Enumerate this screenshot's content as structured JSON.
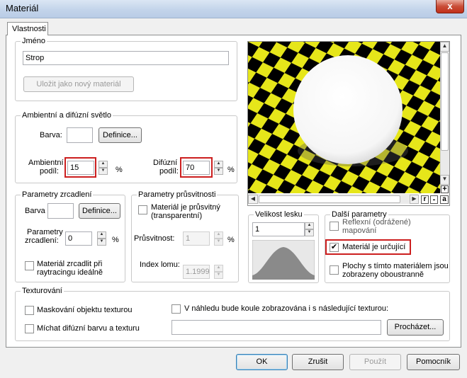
{
  "window": {
    "title": "Materiál",
    "close_glyph": "x"
  },
  "tabs": [
    {
      "label": "Vlastnosti"
    }
  ],
  "name_group": {
    "legend": "Jméno",
    "value": "Strop",
    "save_button": "Uložit jako nový materiál"
  },
  "ambient_group": {
    "legend": "Ambientní a difúzní světlo",
    "color_label": "Barva:",
    "define_button": "Definice...",
    "ambient_label_1": "Ambientní",
    "ambient_label_2": "podíl:",
    "ambient_value": "15",
    "ambient_unit": "%",
    "diffuse_label_1": "Difúzní",
    "diffuse_label_2": "podíl:",
    "diffuse_value": "70",
    "diffuse_unit": "%"
  },
  "mirror_group": {
    "legend": "Parametry zrcadlení",
    "color_label": "Barva",
    "define_button": "Definice...",
    "params_label_1": "Parametry",
    "params_label_2": "zrcadlení:",
    "params_value": "0",
    "params_unit": "%",
    "raytrace_label_1": "Materiál zrcadlit při",
    "raytrace_label_2": "raytracingu ideálně",
    "raytrace_checked": false
  },
  "transparency_group": {
    "legend": "Parametry průsvitnosti",
    "transparent_label_1": "Materiál je průsvitný",
    "transparent_label_2": "(transparentní)",
    "transparent_checked": false,
    "transparency_label": "Průsvitnost:",
    "transparency_value": "1",
    "transparency_unit": "%",
    "index_label": "Index lomu:",
    "index_value": "1.1999"
  },
  "preview": {
    "zoom_in_label": "+",
    "zoom_out_label": "-",
    "btn_r": "r",
    "btn_minus": "-",
    "btn_a": "a",
    "checker_colors": [
      "#e6e61a",
      "#000000"
    ],
    "sphere_color": "#ffffff"
  },
  "gloss_group": {
    "legend": "Velikost lesku",
    "value": "1"
  },
  "more_group": {
    "legend": "Další parametry",
    "reflex_label_1": "Reflexní (odrážené)",
    "reflex_label_2": "mapování",
    "reflex_checked": false,
    "defining_label": "Materiál je určující",
    "defining_checked": true,
    "both_sides_label_1": "Plochy s tímto materiálem jsou",
    "both_sides_label_2": "zobrazeny oboustranně",
    "both_sides_checked": false
  },
  "texture_group": {
    "legend": "Texturování",
    "mask_label": "Maskování objektu texturou",
    "mask_checked": false,
    "mix_label": "Míchat difúzní barvu a texturu",
    "mix_checked": false,
    "preview_texture_label": "V náhledu bude koule zobrazována i s následující texturou:",
    "preview_texture_checked": false,
    "path_value": "",
    "browse_button": "Procházet..."
  },
  "footer": {
    "ok": "OK",
    "cancel": "Zrušit",
    "apply": "Použít",
    "help": "Pomocník"
  },
  "highlight_color": "#cc1f1f"
}
